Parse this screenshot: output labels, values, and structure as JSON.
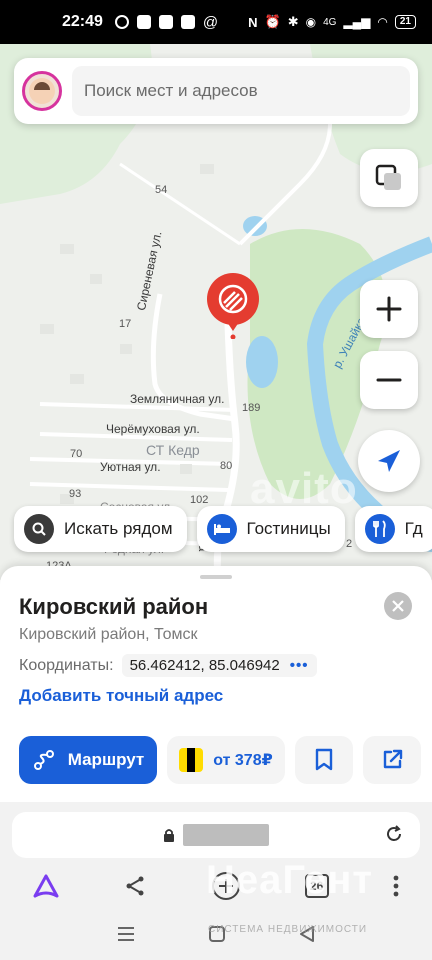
{
  "status_bar": {
    "time": "22:49",
    "network": "4G",
    "battery": "21"
  },
  "search": {
    "placeholder": "Поиск мест и адресов"
  },
  "map": {
    "streets": [
      "Сиреневая ул.",
      "Земляничная ул.",
      "Черёмуховая ул.",
      "Уютная ул.",
      "Сосновая ул.",
      "Родная ул.",
      "р. Ушайка",
      "на"
    ],
    "houses": [
      "54",
      "17",
      "189",
      "70",
      "80",
      "93",
      "102",
      "123А",
      "2"
    ],
    "district": "СТ Кедр",
    "watermark": "avito"
  },
  "chips": [
    {
      "label": "Искать рядом",
      "icon": "search-icon"
    },
    {
      "label": "Гостиницы",
      "icon": "bed-icon"
    },
    {
      "label": "Гд",
      "icon": "fork-knife-icon"
    }
  ],
  "place": {
    "title": "Кировский район",
    "subtitle": "Кировский район, Томск",
    "coords_label": "Координаты:",
    "coords_value": "56.462412, 85.046942",
    "coords_more": "•••",
    "add_address": "Добавить точный адрес"
  },
  "actions": {
    "route_label": "Маршрут",
    "taxi_label": "от 378₽"
  },
  "browser": {
    "tab_count": "26"
  },
  "brand_watermark": {
    "main": "НеаГент",
    "sub": "СИСТЕМА НЕДВИЖИМОСТИ"
  },
  "colors": {
    "accent": "#1a5fd8",
    "pin": "#e43c30",
    "water": "#9fd2ef",
    "forest": "#cfe8c3",
    "alice": "#7a3df0"
  }
}
